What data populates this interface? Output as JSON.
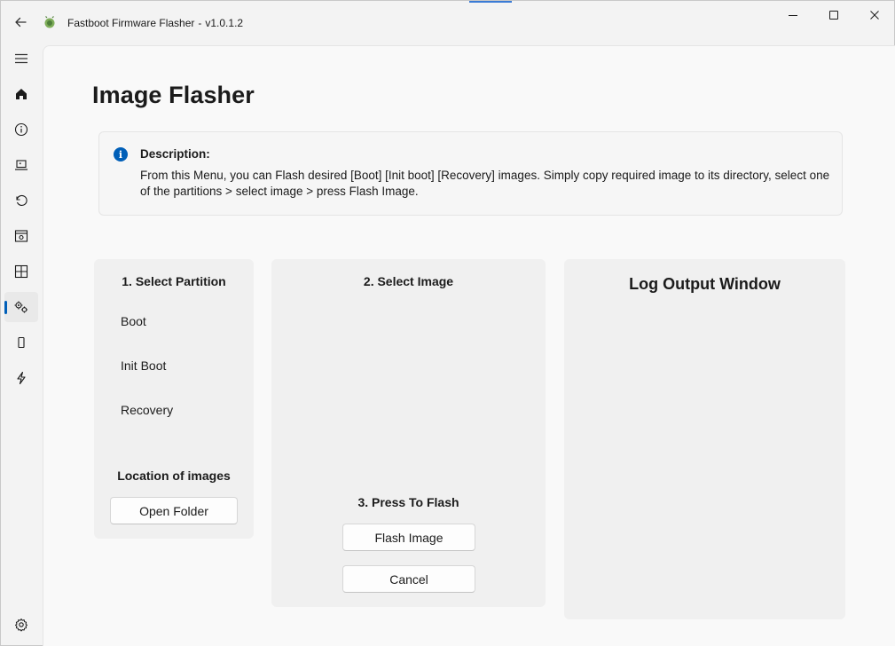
{
  "app": {
    "title": "Fastboot Firmware Flasher",
    "separator": "-",
    "version": "v1.0.1.2"
  },
  "window_buttons": {
    "minimize": "minimize-icon",
    "maximize": "maximize-icon",
    "close": "close-icon"
  },
  "nav": {
    "items": [
      {
        "icon": "hamburger-menu-icon"
      },
      {
        "icon": "home-icon"
      },
      {
        "icon": "info-icon"
      },
      {
        "icon": "laptop-icon"
      },
      {
        "icon": "restore-icon"
      },
      {
        "icon": "window-settings-icon"
      },
      {
        "icon": "grid-icon"
      },
      {
        "icon": "gears-icon",
        "selected": true
      },
      {
        "icon": "phone-icon"
      },
      {
        "icon": "lightning-icon"
      },
      {
        "icon": "settings-icon"
      }
    ],
    "accent_color": "#005fb8"
  },
  "page": {
    "title": "Image Flasher"
  },
  "info": {
    "title": "Description:",
    "message": "From this Menu, you can Flash desired [Boot] [Init boot] [Recovery] images. Simply copy required image to its directory, select one of the partitions > select image > press Flash Image."
  },
  "partition": {
    "heading": "1. Select Partition",
    "options": [
      "Boot",
      "Init Boot",
      "Recovery"
    ],
    "location_heading": "Location of images",
    "open_folder_label": "Open Folder"
  },
  "image": {
    "heading": "2. Select Image",
    "flash_heading": "3. Press To Flash",
    "flash_button_label": "Flash Image",
    "cancel_button_label": "Cancel"
  },
  "log": {
    "title": "Log Output Window"
  }
}
